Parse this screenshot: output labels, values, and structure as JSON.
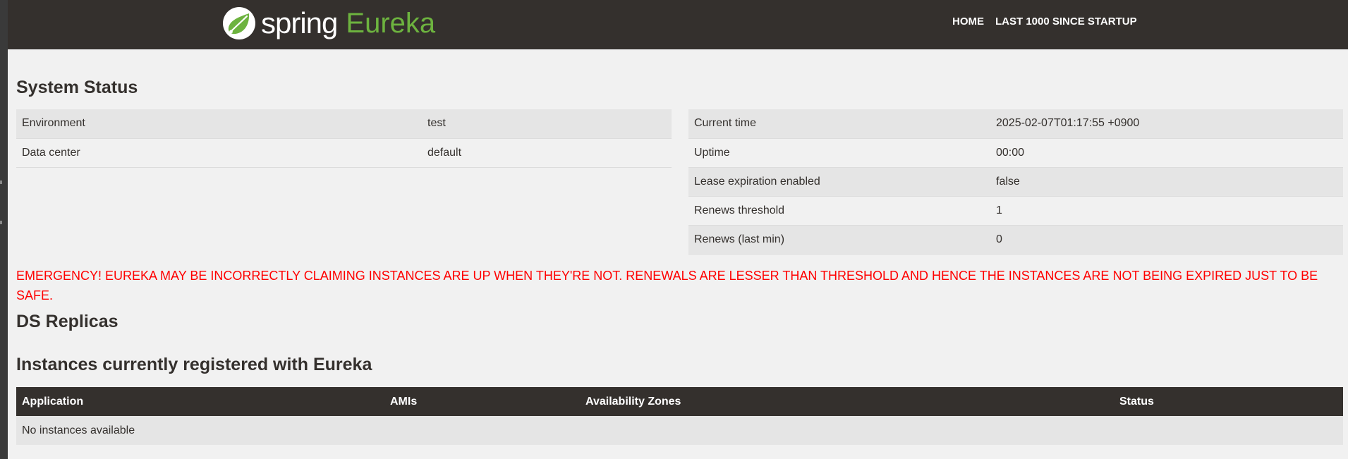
{
  "brand": {
    "word1": "spring",
    "word2": "Eureka",
    "logo_icon": "spring-leaf-icon",
    "accent_color": "#6db33f"
  },
  "nav": {
    "home": "HOME",
    "last1000": "LAST 1000 SINCE STARTUP"
  },
  "system_status": {
    "title": "System Status",
    "left_rows": [
      {
        "label": "Environment",
        "value": "test"
      },
      {
        "label": "Data center",
        "value": "default"
      }
    ],
    "right_rows": [
      {
        "label": "Current time",
        "value": "2025-02-07T01:17:55 +0900"
      },
      {
        "label": "Uptime",
        "value": "00:00"
      },
      {
        "label": "Lease expiration enabled",
        "value": "false"
      },
      {
        "label": "Renews threshold",
        "value": "1"
      },
      {
        "label": "Renews (last min)",
        "value": "0"
      }
    ]
  },
  "emergency": {
    "text": "EMERGENCY! EUREKA MAY BE INCORRECTLY CLAIMING INSTANCES ARE UP WHEN THEY'RE NOT. RENEWALS ARE LESSER THAN THRESHOLD AND HENCE THE INSTANCES ARE NOT BEING EXPIRED JUST TO BE SAFE.",
    "color": "#ff0000"
  },
  "replicas": {
    "title": "DS Replicas"
  },
  "instances": {
    "title": "Instances currently registered with Eureka",
    "columns": [
      "Application",
      "AMIs",
      "Availability Zones",
      "Status"
    ],
    "empty_text": "No instances available"
  }
}
